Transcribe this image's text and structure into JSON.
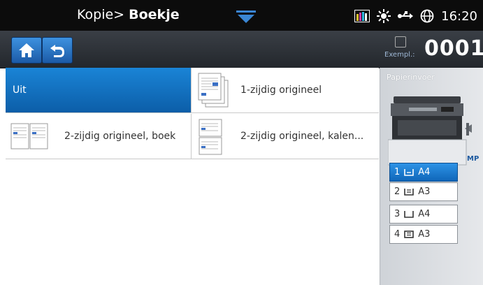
{
  "status": {
    "time": "16:20"
  },
  "header": {
    "breadcrumb_prefix": "Kopie>",
    "title": "Boekje",
    "copies_label": "Exempl.:",
    "copies_value": "0001"
  },
  "options": [
    {
      "label": "Uit",
      "selected": true
    },
    {
      "label": "1-zijdig origineel",
      "selected": false
    },
    {
      "label": "2-zijdig origineel, boek",
      "selected": false
    },
    {
      "label": "2-zijdig origineel, kalen...",
      "selected": false
    }
  ],
  "paper": {
    "title": "Papierinvoer",
    "mp_label": "MP",
    "trays": [
      {
        "number": "1",
        "size": "A4",
        "selected": true
      },
      {
        "number": "2",
        "size": "A3",
        "selected": false
      },
      {
        "number": "3",
        "size": "A4",
        "selected": false
      },
      {
        "number": "4",
        "size": "A3",
        "selected": false
      }
    ]
  },
  "colors": {
    "accent": "#1a84d6",
    "header": "#2d3238"
  }
}
